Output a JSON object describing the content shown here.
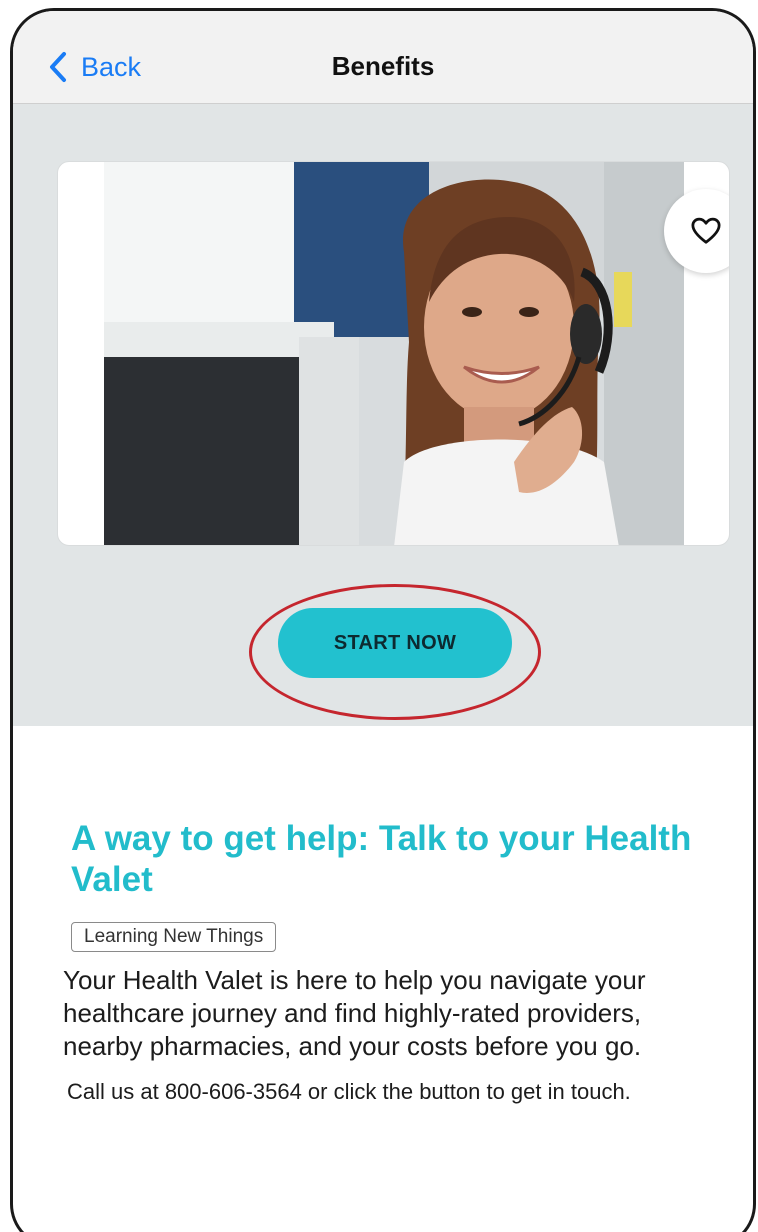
{
  "navbar": {
    "back_label": "Back",
    "title": "Benefits"
  },
  "hero": {
    "image_alt": "Smiling customer service agent wearing a headset",
    "favorite_icon": "heart-icon",
    "cta_label": "START NOW"
  },
  "article": {
    "headline": "A way to get help: Talk to your Health Valet",
    "tag": "Learning New Things",
    "description": "Your Health Valet is here to help you navigate your healthcare journey and find highly-rated providers, nearby pharmacies, and your costs before you go.",
    "call_text": "Call us at 800-606-3564 or click the button to get in touch."
  },
  "colors": {
    "accent": "#22c1cf",
    "link": "#1a7cf5",
    "highlight": "#c5262e",
    "hero_bg": "#e1e5e6"
  }
}
